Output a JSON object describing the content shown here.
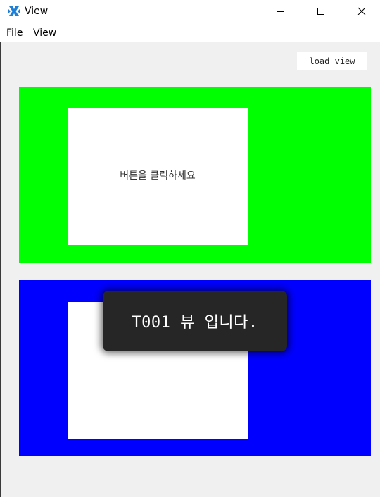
{
  "window": {
    "title": "View",
    "icon": "app-logo-icon",
    "controls": [
      "minimize-icon",
      "maximize-icon",
      "close-icon"
    ]
  },
  "menu": {
    "items": [
      {
        "label": "File"
      },
      {
        "label": "View"
      }
    ]
  },
  "toolbar": {
    "load_view_label": "load view"
  },
  "views": [
    {
      "background": "#00ff00",
      "message": "버튼을 클릭하세요"
    },
    {
      "background": "#0000ff",
      "message": ""
    }
  ],
  "toast": {
    "message": "T001 뷰 입니다."
  },
  "colors": {
    "client_background": "#f0f0f0",
    "toast_background": "#262626",
    "icon_accent": "#1e7fd6"
  }
}
